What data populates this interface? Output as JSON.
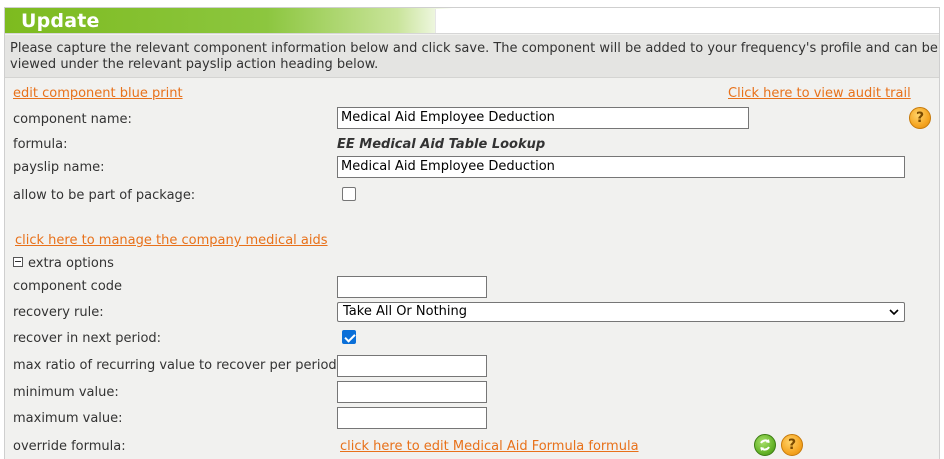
{
  "header": {
    "title": "Update"
  },
  "intro": {
    "line1": "Please capture the relevant component information below and click save. The component will be added to your frequency's profile and can be",
    "line2": "viewed under the relevant payslip action heading below."
  },
  "links": {
    "blueprint": "edit component blue print",
    "audit_trail": "Click here to view audit trail",
    "manage_medical_aids": "click here to manage the company medical aids",
    "edit_formula": "click here to edit Medical Aid Formula formula"
  },
  "form": {
    "component_name_label": "component name:",
    "component_name_value": "Medical Aid Employee Deduction",
    "formula_label": "formula:",
    "formula_value": "EE Medical Aid Table Lookup",
    "payslip_name_label": "payslip name:",
    "payslip_name_value": "Medical Aid Employee Deduction",
    "package_label": "allow to be part of package:",
    "package_checked": false
  },
  "extra": {
    "toggle_label": "extra options",
    "component_code_label": "component code",
    "component_code_value": "",
    "recovery_rule_label": "recovery rule:",
    "recovery_rule_value": "Take All Or Nothing",
    "recover_next_label": "recover in next period:",
    "recover_next_checked": true,
    "max_ratio_label": "max ratio of recurring value to recover per period:",
    "max_ratio_value": "",
    "min_value_label": "minimum value:",
    "min_value_value": "",
    "max_value_label": "maximum value:",
    "max_value_value": "",
    "override_label": "override formula:"
  },
  "icons": {
    "help": "help-icon",
    "refresh": "refresh-icon",
    "help_glyph": "?"
  },
  "colors": {
    "accent_green": "#8cc63f",
    "link_orange": "#e8711a",
    "panel_bg": "#f1f1ef"
  }
}
